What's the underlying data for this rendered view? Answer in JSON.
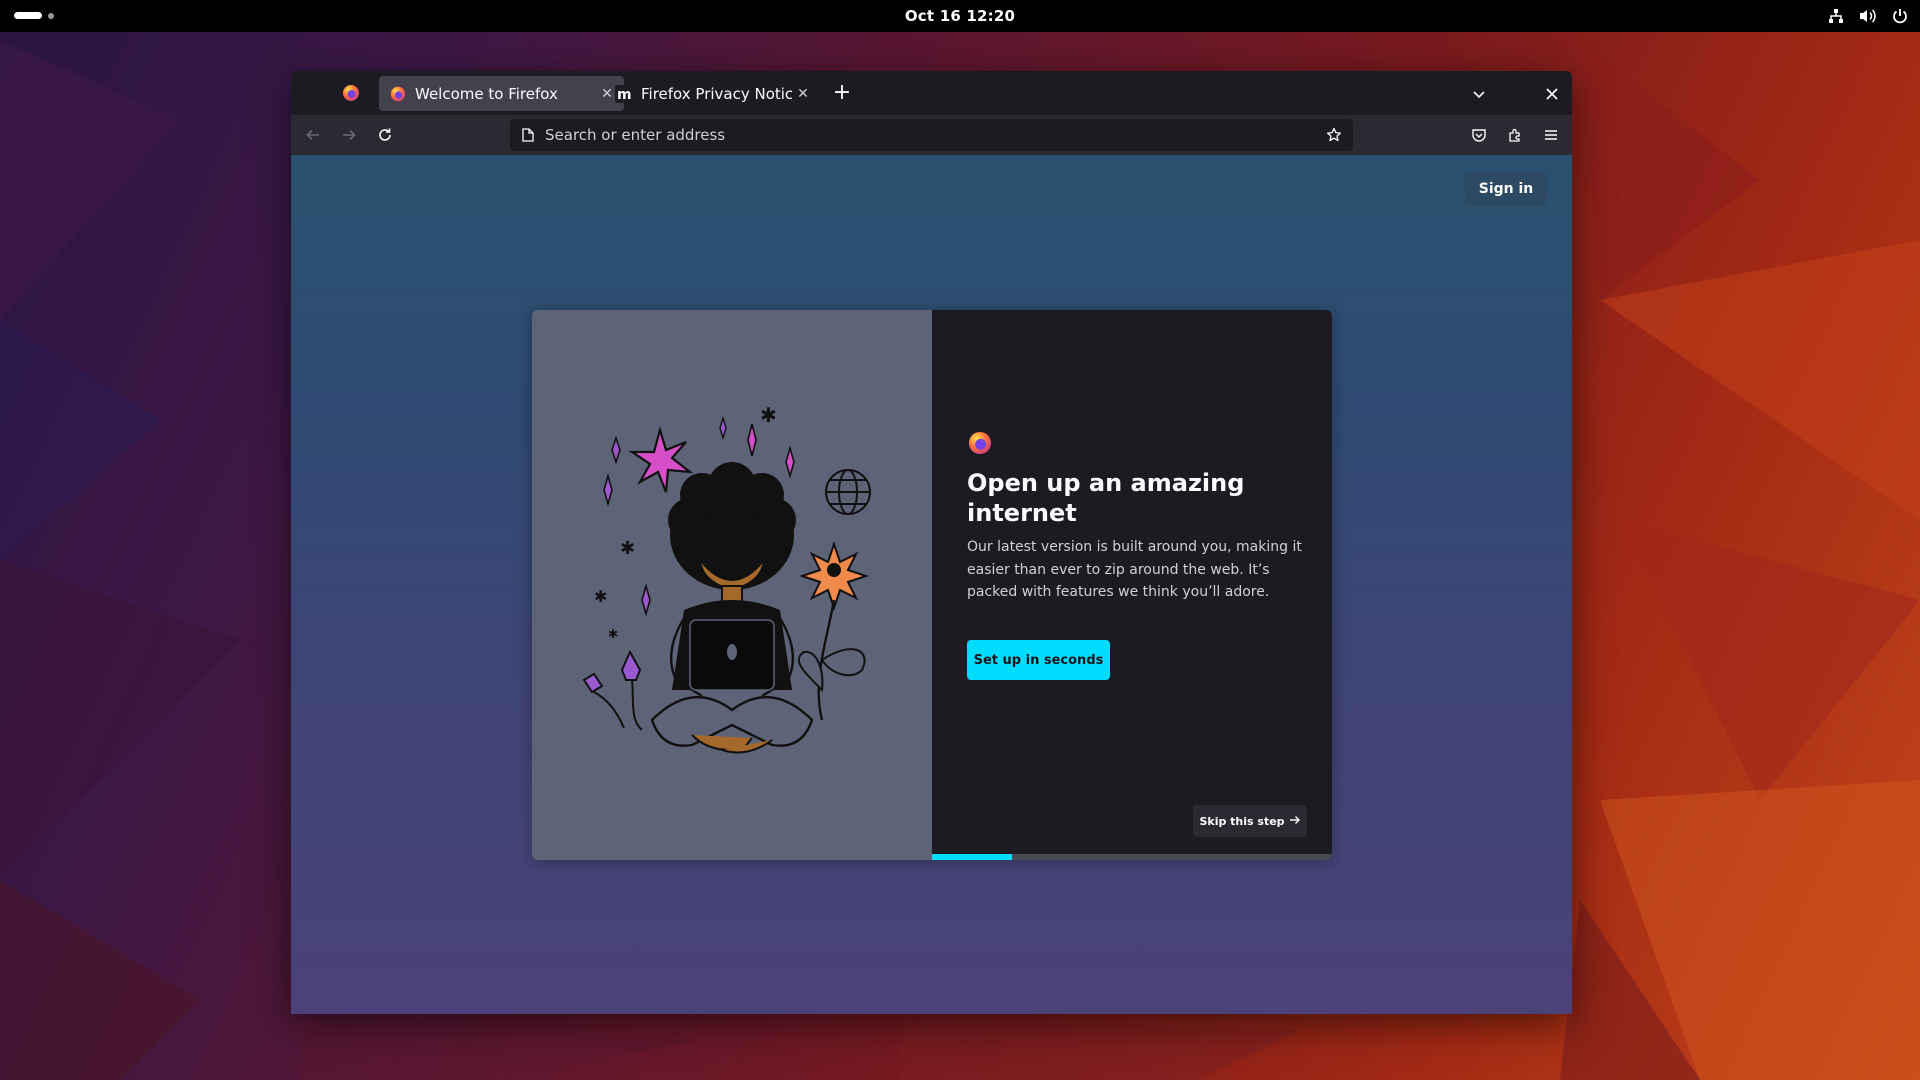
{
  "desktop": {
    "clock": "Oct 16  12:20",
    "tray_icons": [
      "network-icon",
      "volume-icon",
      "power-icon"
    ]
  },
  "browser": {
    "tabs": [
      {
        "title": "Welcome to Firefox",
        "active": true,
        "favicon": "firefox-icon"
      },
      {
        "title": "Firefox Privacy Notice — M",
        "active": false,
        "favicon": "mozilla-m-icon"
      }
    ],
    "new_tab_label": "+",
    "close_tab_label": "✕",
    "url_placeholder": "Search or enter address"
  },
  "page": {
    "signin_label": "Sign in",
    "headline": "Open up an amazing internet",
    "subtext": "Our latest version is built around you, making it easier than ever to zip around the web. It’s packed with features we think you’ll adore.",
    "primary_button": "Set up in seconds",
    "skip_button": "Skip this step",
    "progress": 0.2
  },
  "colors": {
    "accent": "#00ddff",
    "toolbar": "#2b2a33",
    "tab_strip": "#1c1b22",
    "card_dark": "#1c1b22"
  }
}
